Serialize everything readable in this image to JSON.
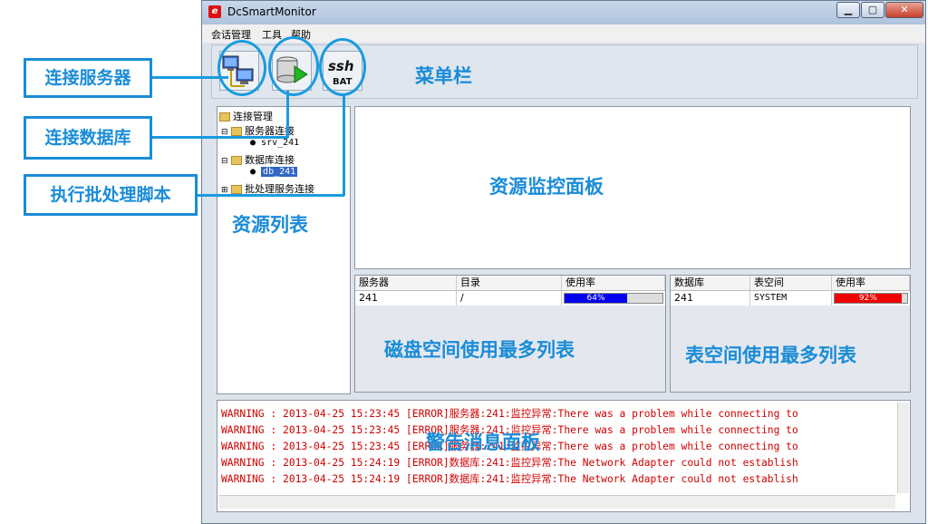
{
  "window": {
    "title": "DcSmartMonitor",
    "icon": "app-logo-icon"
  },
  "menu": [
    "会话管理",
    "工具",
    "帮助"
  ],
  "toolbar": {
    "ssh_label": "ssh",
    "bat_label": "BAT"
  },
  "tree": {
    "root": "连接管理",
    "server_group": "服务器连接",
    "server_item": "srv_241",
    "db_group": "数据库连接",
    "db_item": "db_241",
    "batch_group": "批处理服务连接"
  },
  "disk_table": {
    "headers": [
      "服务器",
      "目录",
      "使用率"
    ],
    "row": {
      "server": "241",
      "dir": "/",
      "usage_text": "64%",
      "usage": 64
    }
  },
  "tablespace_table": {
    "headers": [
      "数据库",
      "表空间",
      "使用率"
    ],
    "row": {
      "db": "241",
      "space": "SYSTEM",
      "usage_text": "92%",
      "usage": 92
    }
  },
  "log": {
    "lines": [
      "WARNING : 2013-04-25 15:23:45 [ERROR]服务器:241:监控异常:There was a problem while connecting to",
      "WARNING : 2013-04-25 15:23:45 [ERROR]服务器:241:监控异常:There was a problem while connecting to",
      "WARNING : 2013-04-25 15:23:45 [ERROR]服务器:241:监控异常:There was a problem while connecting to",
      "WARNING : 2013-04-25 15:24:19 [ERROR]数据库:241:监控异常:The Network Adapter could not establish",
      "WARNING : 2013-04-25 15:24:19 [ERROR]数据库:241:监控异常:The Network Adapter could not establish"
    ]
  },
  "annotations": {
    "connect_server": "连接服务器",
    "connect_db": "连接数据库",
    "run_batch": "执行批处理脚本",
    "menu_bar": "菜单栏",
    "resource_list": "资源列表",
    "monitor_panel": "资源监控面板",
    "disk_top": "磁盘空间使用最多列表",
    "ts_top": "表空间使用最多列表",
    "alert_panel": "警告消息面板"
  },
  "colors": {
    "accent": "#1a8cd8",
    "disk_bar": "#0000ee",
    "ts_bar": "#ee0000",
    "log_text": "#d10000"
  }
}
